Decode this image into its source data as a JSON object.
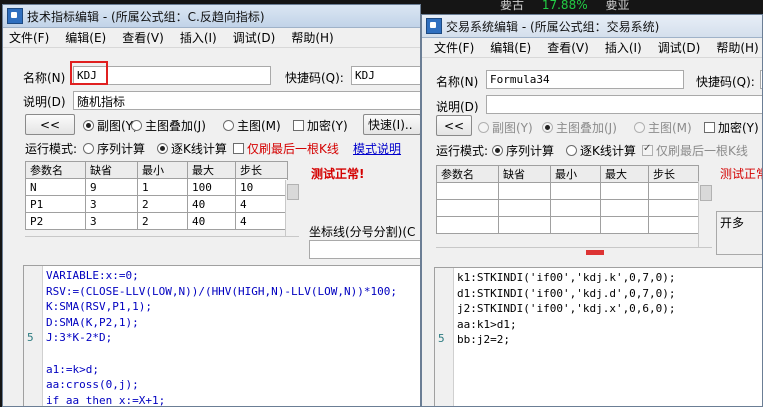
{
  "background": {
    "top_numbers": [
      "要古",
      "17.88%",
      "要亚"
    ],
    "accent_green": "#22cc44",
    "accent_red": "#dd3333"
  },
  "window1": {
    "title": "技术指标编辑 - (所属公式组：C.反趋向指标)",
    "menu": [
      "文件(F)",
      "编辑(E)",
      "查看(V)",
      "插入(I)",
      "调试(D)",
      "帮助(H)"
    ],
    "name_label": "名称(N)",
    "name_value": "KDJ",
    "shortcut_label": "快捷码(Q):",
    "shortcut_value": "KDJ",
    "desc_label": "说明(D)",
    "desc_value": "随机指标",
    "collapse_button": "<<",
    "radio_sub": "副图(Y)",
    "radio_overlay": "主图叠加(J)",
    "radio_main": "主图(M)",
    "check_encrypt": "加密(Y)",
    "quick_button": "快速(I)..",
    "run_mode_label": "运行模式:",
    "run_seq": "序列计算",
    "run_kline": "逐K线计算",
    "refresh_last": "仅刷最后一根K线",
    "mode_help": "模式说明",
    "test_status": "测试正常!",
    "coord_label": "坐标线(分号分割)(C",
    "param_headers": [
      "参数名",
      "缺省",
      "最小",
      "最大",
      "步长"
    ],
    "params": [
      [
        "N",
        "9",
        "1",
        "100",
        "10"
      ],
      [
        "P1",
        "3",
        "2",
        "40",
        "4"
      ],
      [
        "P2",
        "3",
        "2",
        "40",
        "4"
      ]
    ],
    "code_lines": [
      "VARIABLE:x:=0;",
      "RSV:=(CLOSE-LLV(LOW,N))/(HHV(HIGH,N)-LLV(LOW,N))*100;",
      "K:SMA(RSV,P1,1);",
      "D:SMA(K,P2,1);",
      "J:3*K-2*D;",
      "",
      "a1:=k>d;",
      "aa:cross(0,j);",
      "if aa then x:=X+1;"
    ],
    "line_number": "5"
  },
  "window2": {
    "title": "交易系统编辑 - (所属公式组：交易系统)",
    "menu": [
      "文件(F)",
      "编辑(E)",
      "查看(V)",
      "插入(I)",
      "调试(D)",
      "帮助(H)"
    ],
    "name_label": "名称(N)",
    "name_value": "Formula34",
    "shortcut_label": "快捷码(Q):",
    "desc_label": "说明(D)",
    "collapse_button": "<<",
    "radio_sub": "副图(Y)",
    "radio_main_overlay": "主图叠加(J)",
    "radio_main": "主图(M)",
    "check_encrypt": "加密(Y)",
    "run_mode_label": "运行模式:",
    "run_seq": "序列计算",
    "run_kline": "逐K线计算",
    "refresh_last": "仅刷最后一根K线",
    "test_status": "测试正常",
    "open_label": "开多",
    "param_headers": [
      "参数名",
      "缺省",
      "最小",
      "最大",
      "步长"
    ],
    "code_lines": [
      "k1:STKINDI('if00','kdj.k',0,7,0);",
      "d1:STKINDI('if00','kdj.d',0,7,0);",
      "j2:STKINDI('if00','kdj.x',0,6,0);",
      "aa:k1>d1;",
      "bb:j2=2;"
    ],
    "line_number": "5"
  }
}
